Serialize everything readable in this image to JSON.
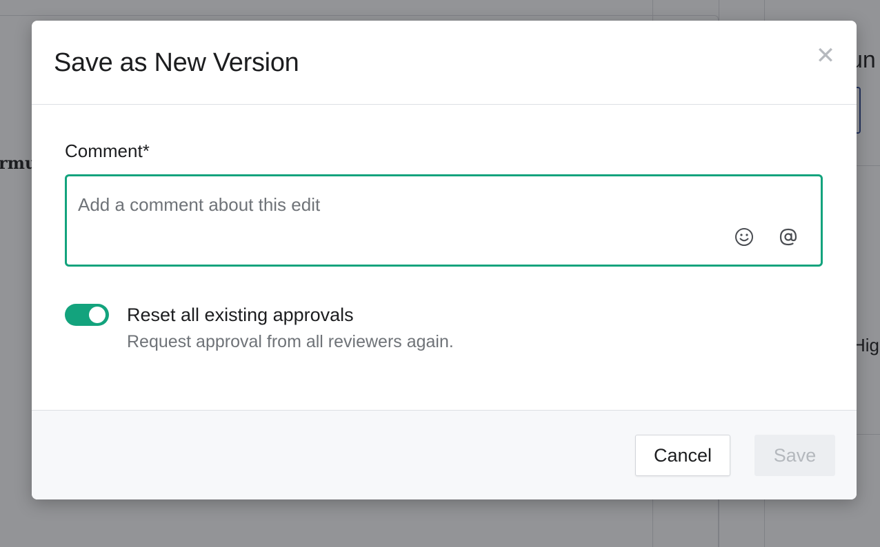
{
  "background": {
    "fragment_left": "rmu",
    "fragment_top_right": "un",
    "fragment_right": "Hig"
  },
  "modal": {
    "title": "Save as New Version",
    "close_icon": "close-icon",
    "comment": {
      "label": "Comment*",
      "placeholder": "Add a comment about this edit",
      "value": "",
      "emoji_icon": "smiley-icon",
      "mention_icon": "at-icon"
    },
    "reset_approvals": {
      "enabled": true,
      "title": "Reset all existing approvals",
      "description": "Request approval from all reviewers again."
    },
    "footer": {
      "cancel_label": "Cancel",
      "save_label": "Save",
      "save_disabled": true
    }
  },
  "colors": {
    "accent": "#13a37d",
    "overlay": "rgba(40,42,48,0.5)"
  }
}
